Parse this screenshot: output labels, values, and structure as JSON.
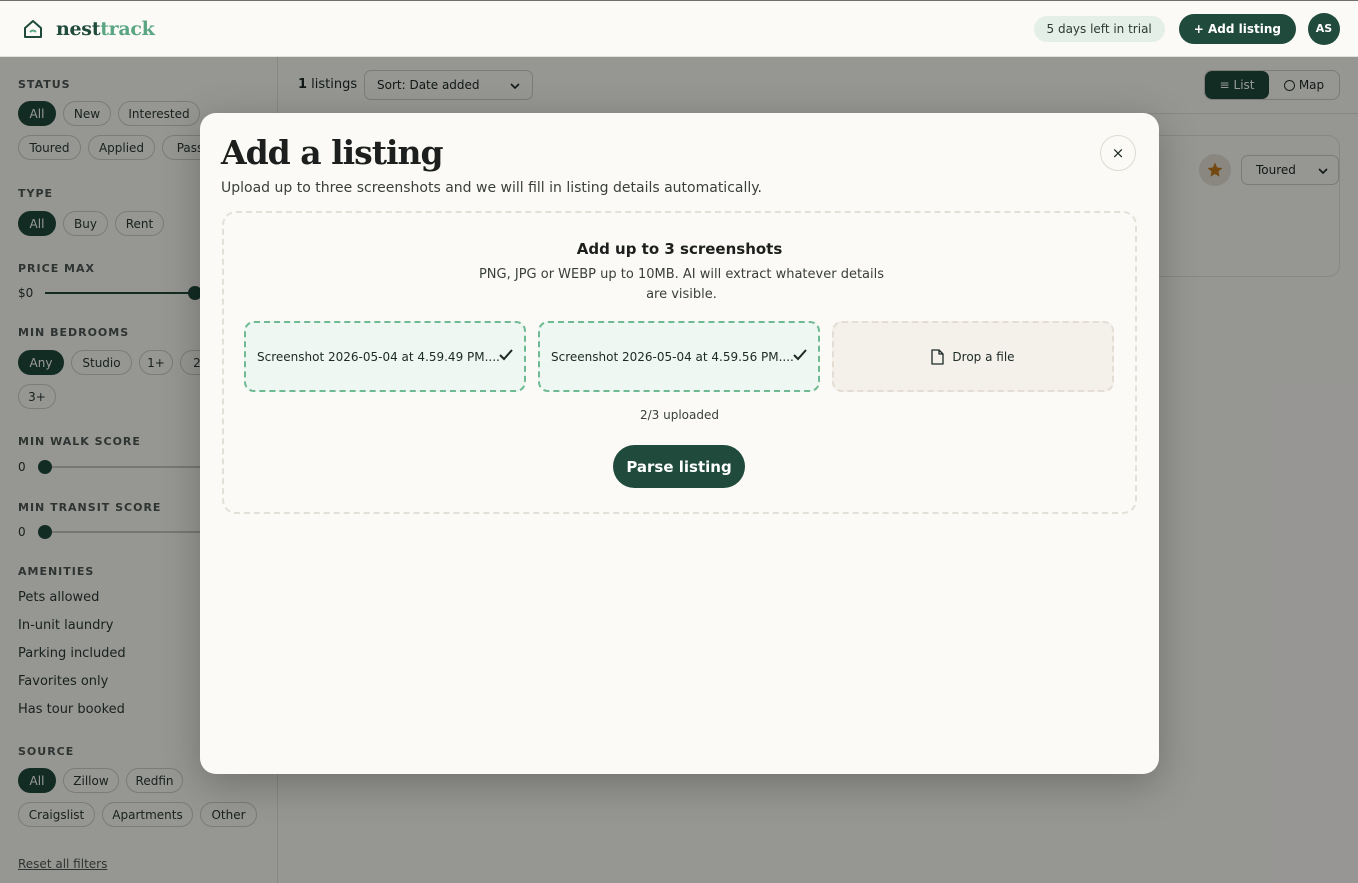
{
  "header": {
    "brand_part1": "nest",
    "brand_part2": "track",
    "trial_text": "5 days left in trial",
    "add_listing_label": "+ Add listing",
    "avatar_initials": "AS"
  },
  "sidebar": {
    "status": {
      "title": "STATUS",
      "chips": [
        "All",
        "New",
        "Interested",
        "Toured",
        "Applied",
        "Pass"
      ],
      "active": "All"
    },
    "type": {
      "title": "TYPE",
      "chips": [
        "All",
        "Buy",
        "Rent"
      ],
      "active": "All"
    },
    "price_max": {
      "title": "PRICE MAX",
      "value": "$0"
    },
    "min_bedrooms": {
      "title": "MIN BEDROOMS",
      "chips": [
        "Any",
        "Studio",
        "1+",
        "2",
        "3+"
      ],
      "active": "Any"
    },
    "min_walk_score": {
      "title": "MIN WALK SCORE",
      "value": "0"
    },
    "min_transit_score": {
      "title": "MIN TRANSIT SCORE",
      "value": "0"
    },
    "amenities": {
      "title": "AMENITIES",
      "items": [
        "Pets allowed",
        "In-unit laundry",
        "Parking included",
        "Favorites only",
        "Has tour booked"
      ]
    },
    "source": {
      "title": "SOURCE",
      "chips": [
        "All",
        "Zillow",
        "Redfin",
        "Craigslist",
        "Apartments",
        "Other"
      ],
      "active": "All"
    },
    "reset_label": "Reset all filters"
  },
  "main": {
    "listing_count": "1",
    "listing_count_suffix": " listings",
    "sort_label": "Sort: Date added",
    "view_list": "List",
    "view_map": "Map",
    "card_status": "Toured"
  },
  "modal": {
    "title": "Add a listing",
    "subtitle": "Upload up to three screenshots and we will fill in listing details automatically.",
    "close_label": "×",
    "dropzone_title": "Add up to 3 screenshots",
    "dropzone_subtitle": "PNG, JPG or WEBP up to 10MB. AI will extract whatever details are visible.",
    "slots": [
      {
        "filename": "Screenshot 2026-05-04 at 4.59.49 PM....",
        "done": true
      },
      {
        "filename": "Screenshot 2026-05-04 at 4.59.56 PM....",
        "done": true
      },
      {
        "filename": "Drop a file",
        "done": false
      }
    ],
    "uploaded_text": "2/3 uploaded",
    "parse_label": "Parse listing"
  },
  "colors": {
    "primary": "#1f4a3c",
    "accent": "#5aa582",
    "background": "#fbfaf6",
    "star": "#c27a1d"
  }
}
